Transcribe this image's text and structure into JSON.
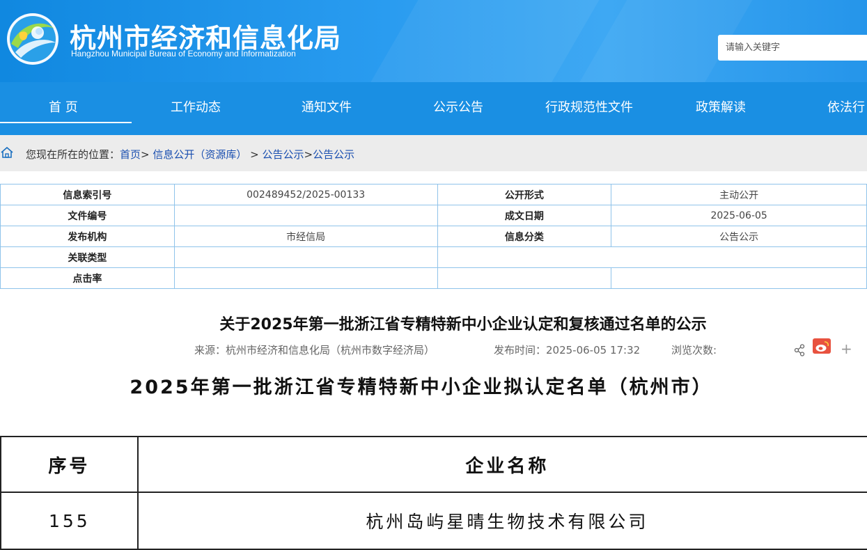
{
  "header": {
    "title": "杭州市经济和信息化局",
    "subtitle": "Hangzhou Municipal Bureau of Economy and Informatization",
    "search_placeholder": "请输入关键字",
    "brand_color": "#1a8fe3"
  },
  "nav": {
    "items": [
      "首 页",
      "工作动态",
      "通知文件",
      "公示公告",
      "行政规范性文件",
      "政策解读",
      "依法行"
    ]
  },
  "breadcrumb": {
    "prefix": "您现在所在的位置：",
    "home": "首页",
    "sep1": ">",
    "level1": "信息公开（资源库）",
    "sep2": " > ",
    "level2": "公告公示",
    "sep3": ">",
    "level3": "公告公示"
  },
  "meta": {
    "index_label": "信息索引号",
    "index_value": "002489452/2025-00133",
    "form_label": "公开形式",
    "form_value": "主动公开",
    "docno_label": "文件编号",
    "docno_value": "",
    "date_label": "成文日期",
    "date_value": "2025-06-05",
    "org_label": "发布机构",
    "org_value": "市经信局",
    "category_label": "信息分类",
    "category_value": "公告公示",
    "related_label": "关联类型",
    "clicks_label": "点击率"
  },
  "article": {
    "title": "关于2025年第一批浙江省专精特新中小企业认定和复核通过名单的公示",
    "source": "来源：杭州市经济和信息化局（杭州市数字经济局）",
    "published": "发布时间：2025-06-05 17:32",
    "views": "浏览次数:",
    "plus": "+"
  },
  "document": {
    "heading": "2025年第一批浙江省专精特新中小企业拟认定名单（杭州市）",
    "col_no": "序号",
    "col_name": "企业名称",
    "rows": [
      {
        "no": "155",
        "name": "杭州岛屿星晴生物技术有限公司"
      }
    ]
  }
}
